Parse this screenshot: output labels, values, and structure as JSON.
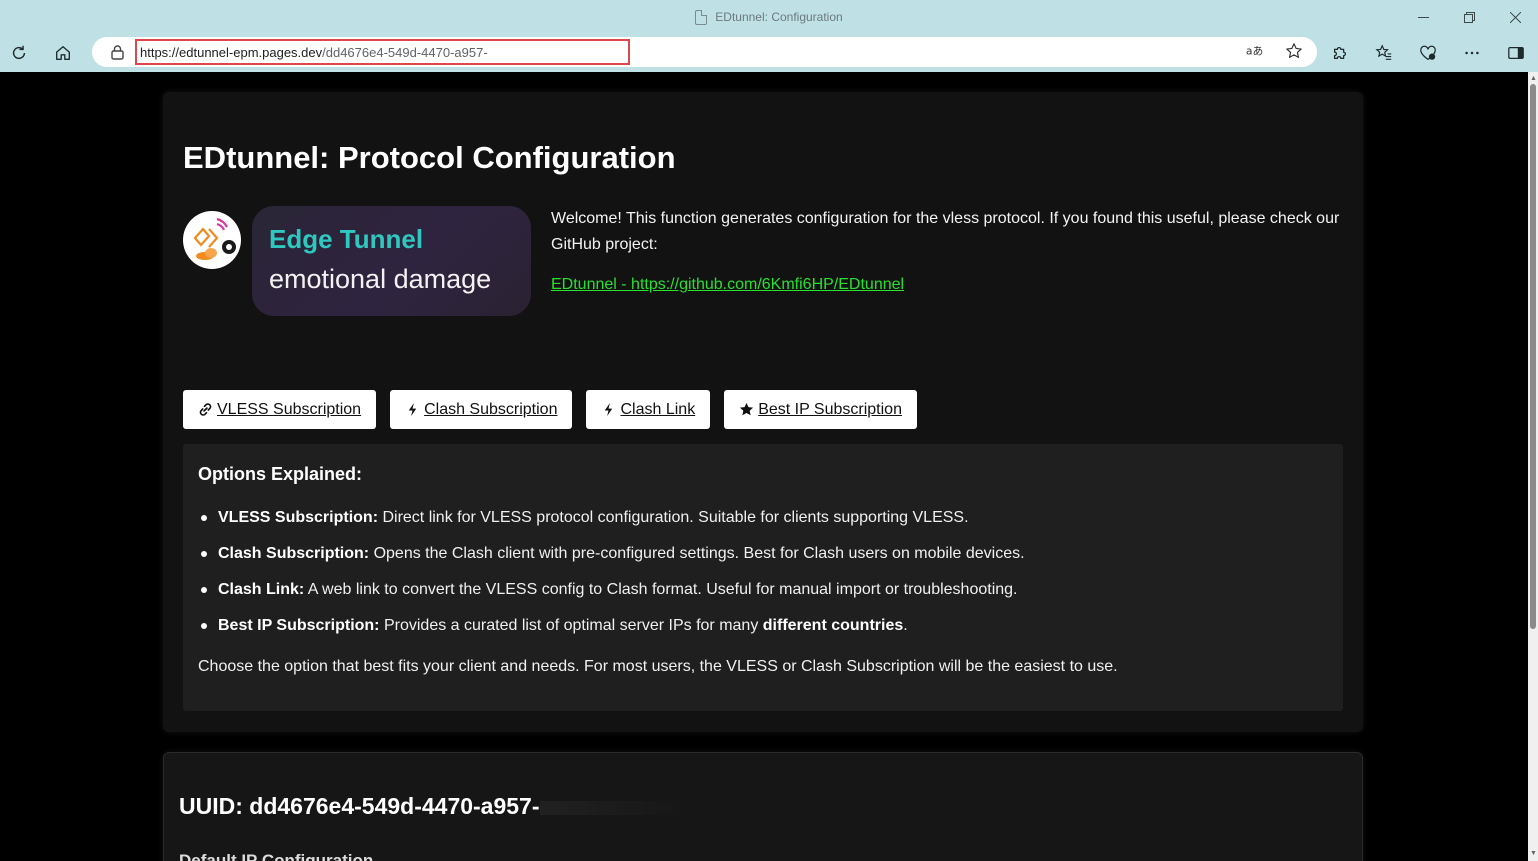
{
  "browser": {
    "tab_title": "EDtunnel: Configuration",
    "url_main": "https://edtunnel-epm.pages.dev",
    "url_path": "/dd4676e4-549d-4470-a957-"
  },
  "page": {
    "title": "EDtunnel: Protocol Configuration",
    "banner_line1": "Edge Tunnel",
    "banner_line2": "emotional damage",
    "welcome": "Welcome! This function generates configuration for the vless protocol. If you found this useful, please check our GitHub project:",
    "github_link": "EDtunnel - https://github.com/6Kmfi6HP/EDtunnel",
    "buttons": {
      "vless": "VLESS Subscription",
      "clash": "Clash Subscription",
      "clash_link": "Clash Link",
      "best_ip": "Best IP Subscription"
    },
    "options": {
      "title": "Options Explained:",
      "items": [
        {
          "term": "VLESS Subscription:",
          "desc": " Direct link for VLESS protocol configuration. Suitable for clients supporting VLESS."
        },
        {
          "term": "Clash Subscription:",
          "desc": " Opens the Clash client with pre-configured settings. Best for Clash users on mobile devices."
        },
        {
          "term": "Clash Link:",
          "desc": " A web link to convert the VLESS config to Clash format. Useful for manual import or troubleshooting."
        },
        {
          "term": "Best IP Subscription:",
          "desc": " Provides a curated list of optimal server IPs for many ",
          "bold_tail": "different countries",
          "tail": "."
        }
      ],
      "footer": "Choose the option that best fits your client and needs. For most users, the VLESS or Clash Subscription will be the easiest to use."
    },
    "uuid_label": "UUID: dd4676e4-549d-4470-a957-",
    "next_section": "Default IP Configuration"
  },
  "colors": {
    "chrome": "#bfe1e6",
    "link_green": "#29e02f",
    "banner_teal": "#2ec8c0",
    "url_highlight": "#e0464a"
  }
}
